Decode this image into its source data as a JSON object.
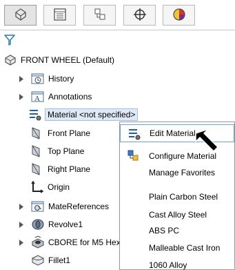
{
  "tabs": [
    {
      "icon": "feature-manager-icon",
      "active": true
    },
    {
      "icon": "property-manager-icon",
      "active": false
    },
    {
      "icon": "configuration-manager-icon",
      "active": false
    },
    {
      "icon": "dimxpert-manager-icon",
      "active": false
    },
    {
      "icon": "display-manager-icon",
      "active": false
    }
  ],
  "filter_icon": "filter-icon",
  "tree": {
    "root": "FRONT WHEEL  (Default)",
    "items": [
      {
        "label": "History",
        "icon": "history-folder-icon",
        "expandable": true
      },
      {
        "label": "Annotations",
        "icon": "annotations-folder-icon",
        "expandable": true
      },
      {
        "label": "Material <not specified>",
        "icon": "material-icon",
        "expandable": false,
        "selected": true
      },
      {
        "label": "Front Plane",
        "icon": "plane-icon",
        "expandable": false
      },
      {
        "label": "Top Plane",
        "icon": "plane-icon",
        "expandable": false
      },
      {
        "label": "Right Plane",
        "icon": "plane-icon",
        "expandable": false
      },
      {
        "label": "Origin",
        "icon": "origin-icon",
        "expandable": false
      },
      {
        "label": "MateReferences",
        "icon": "mate-references-icon",
        "expandable": true
      },
      {
        "label": "Revolve1",
        "icon": "revolve-icon",
        "expandable": true
      },
      {
        "label": "CBORE for M5 Hex",
        "icon": "hole-wizard-icon",
        "expandable": true
      },
      {
        "label": "Fillet1",
        "icon": "fillet-icon",
        "expandable": false
      }
    ]
  },
  "context_menu": {
    "items": [
      {
        "label": "Edit Material",
        "icon": "edit-material-icon",
        "highlighted": true
      },
      {
        "label": "Configure Material",
        "icon": "configure-material-icon"
      },
      {
        "label": "Manage Favorites"
      },
      {
        "label": "Plain Carbon Steel"
      },
      {
        "label": "Cast Alloy Steel"
      },
      {
        "label": "ABS PC"
      },
      {
        "label": "Malleable Cast Iron"
      },
      {
        "label": "1060 Alloy"
      }
    ]
  },
  "colors": {
    "selection_bg": "#dfe9f6",
    "selection_border": "#9fbfe4",
    "menu_highlight_border": "#6ea0d8"
  }
}
